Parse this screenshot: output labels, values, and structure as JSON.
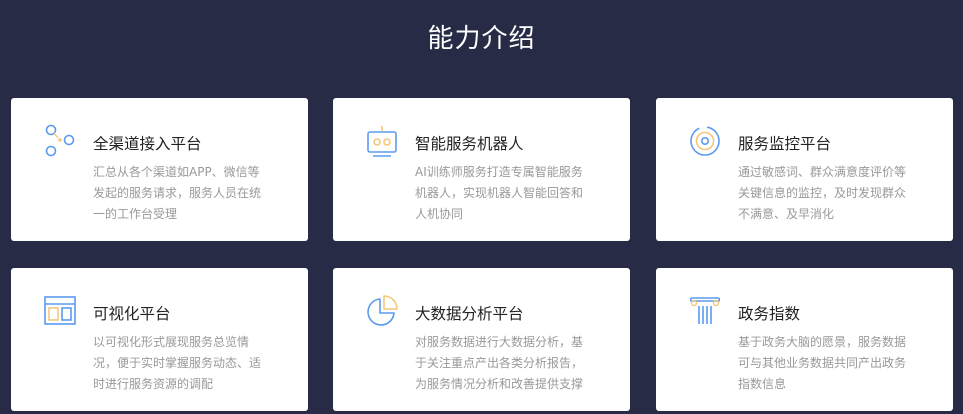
{
  "page": {
    "title": "能力介绍"
  },
  "colors": {
    "background": "#272b45",
    "card": "#ffffff",
    "accent": "#5b9bef",
    "accent_light": "#f3c77a"
  },
  "cards": [
    {
      "icon": "omni-channel-icon",
      "title": "全渠道接入平台",
      "desc": "汇总从各个渠道如APP、微信等发起的服务请求，服务人员在统一的工作台受理"
    },
    {
      "icon": "robot-icon",
      "title": "智能服务机器人",
      "desc": "AI训练师服务打造专属智能服务机器人，实现机器人智能回答和人机协同"
    },
    {
      "icon": "monitor-icon",
      "title": "服务监控平台",
      "desc": "通过敏感词、群众满意度评价等关键信息的监控，及时发现群众不满意、及早消化"
    },
    {
      "icon": "visualization-icon",
      "title": "可视化平台",
      "desc": "以可视化形式展现服务总览情况，便于实时掌握服务动态、适时进行服务资源的调配"
    },
    {
      "icon": "pie-chart-icon",
      "title": "大数据分析平台",
      "desc": "对服务数据进行大数据分析，基于关注重点产出各类分析报告，为服务情况分析和改善提供支撑"
    },
    {
      "icon": "pillar-icon",
      "title": "政务指数",
      "desc": "基于政务大脑的愿景，服务数据可与其他业务数据共同产出政务指数信息"
    }
  ]
}
